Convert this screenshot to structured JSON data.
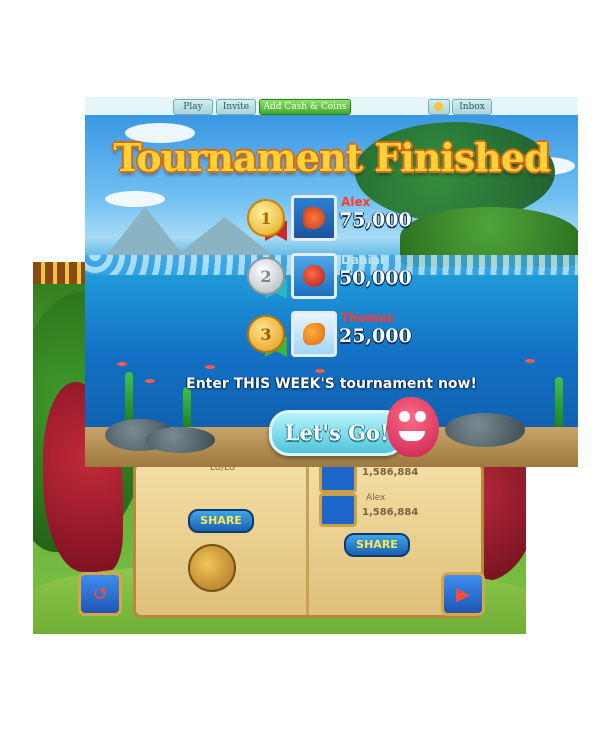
{
  "topbar": {
    "tabs": [
      {
        "label": "Play",
        "style": "normal"
      },
      {
        "label": "Invite",
        "style": "normal"
      },
      {
        "label": "Add Cash & Coins",
        "style": "green"
      },
      {
        "label": "Inbox",
        "style": "normal"
      }
    ]
  },
  "tournament": {
    "title": "Tournament Finished",
    "rankings": [
      {
        "rank": "1",
        "medal": "gold",
        "name": "Alex",
        "score": "75,000",
        "name_color": "#ff3b2f",
        "avatar_icon": "seahorse-icon"
      },
      {
        "rank": "2",
        "medal": "silver",
        "name": "Danial",
        "score": "50,000",
        "name_color": "#bfe3f2",
        "avatar_icon": "red-fish-icon"
      },
      {
        "rank": "3",
        "medal": "bronze",
        "name": "Thomas",
        "score": "25,000",
        "name_color": "#ff3b2f",
        "avatar_icon": "orange-fish-icon"
      }
    ],
    "cta_text": "Enter THIS WEEK'S tournament now!",
    "button_label": "Let's Go!"
  },
  "back_panel": {
    "left_share_label": "SHARE",
    "right_share_label": "SHARE",
    "left_partial_text": "LU/LU",
    "slots": [
      {
        "name": "",
        "score": "1,586,884"
      },
      {
        "name": "Alex",
        "score": "1,586,884"
      }
    ],
    "left_nav_icon": "back-arrow-icon",
    "right_nav_icon": "play-icon"
  },
  "colors": {
    "accent_gold": "#ffd23a",
    "ocean_blue": "#1370c4",
    "button_teal": "#4fc4db",
    "tab_green": "#41a827"
  }
}
